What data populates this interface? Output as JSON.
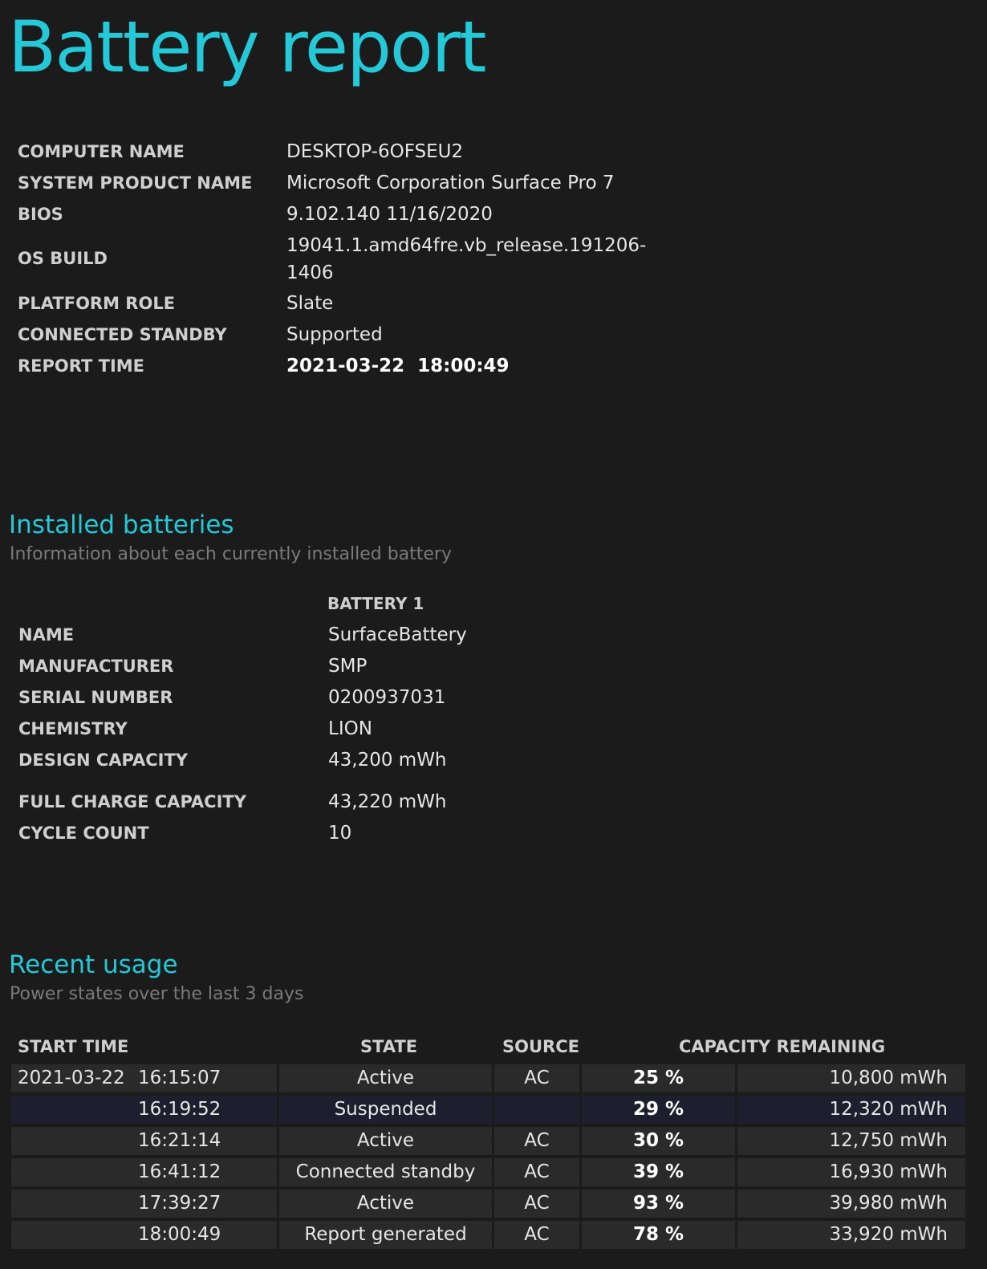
{
  "title": "Battery report",
  "system_info": [
    {
      "label": "COMPUTER NAME",
      "value": "DESKTOP-6OFSEU2"
    },
    {
      "label": "SYSTEM PRODUCT NAME",
      "value": "Microsoft Corporation Surface Pro 7"
    },
    {
      "label": "BIOS",
      "value": "9.102.140 11/16/2020"
    },
    {
      "label": "OS BUILD",
      "value_line1": "19041.1.amd64fre.vb_release.191206-",
      "value_line2": "1406"
    },
    {
      "label": "PLATFORM ROLE",
      "value": "Slate"
    },
    {
      "label": "CONNECTED STANDBY",
      "value": "Supported"
    },
    {
      "label": "REPORT TIME",
      "value": "2021-03-22  18:00:49"
    }
  ],
  "installed_batteries": {
    "heading": "Installed batteries",
    "subtitle": "Information about each currently installed battery",
    "column_header": "BATTERY 1",
    "rows": [
      {
        "label": "NAME",
        "value": "SurfaceBattery"
      },
      {
        "label": "MANUFACTURER",
        "value": "SMP"
      },
      {
        "label": "SERIAL NUMBER",
        "value": "0200937031"
      },
      {
        "label": "CHEMISTRY",
        "value": "LION"
      },
      {
        "label": "DESIGN CAPACITY",
        "value": "43,200 mWh"
      },
      {
        "label": "FULL CHARGE CAPACITY",
        "value": "43,220 mWh"
      },
      {
        "label": "CYCLE COUNT",
        "value": "10"
      }
    ]
  },
  "recent_usage": {
    "heading": "Recent usage",
    "subtitle": "Power states over the last 3 days",
    "headers": {
      "start_time": "START TIME",
      "state": "STATE",
      "source": "SOURCE",
      "capacity_remaining": "CAPACITY REMAINING"
    },
    "rows": [
      {
        "date": "2021-03-22",
        "time": "16:15:07",
        "state": "Active",
        "source": "AC",
        "percent": "25 %",
        "mwh": "10,800 mWh"
      },
      {
        "date": "",
        "time": "16:19:52",
        "state": "Suspended",
        "source": "",
        "percent": "29 %",
        "mwh": "12,320 mWh"
      },
      {
        "date": "",
        "time": "16:21:14",
        "state": "Active",
        "source": "AC",
        "percent": "30 %",
        "mwh": "12,750 mWh"
      },
      {
        "date": "",
        "time": "16:41:12",
        "state": "Connected standby",
        "source": "AC",
        "percent": "39 %",
        "mwh": "16,930 mWh"
      },
      {
        "date": "",
        "time": "17:39:27",
        "state": "Active",
        "source": "AC",
        "percent": "93 %",
        "mwh": "39,980 mWh"
      },
      {
        "date": "",
        "time": "18:00:49",
        "state": "Report generated",
        "source": "AC",
        "percent": "78 %",
        "mwh": "33,920 mWh"
      }
    ]
  },
  "colors": {
    "background": "#1b1b1b",
    "accent": "#24c8d6",
    "row_bg": "#2a2a2a",
    "row_bg_suspended": "#1e1e2e"
  }
}
